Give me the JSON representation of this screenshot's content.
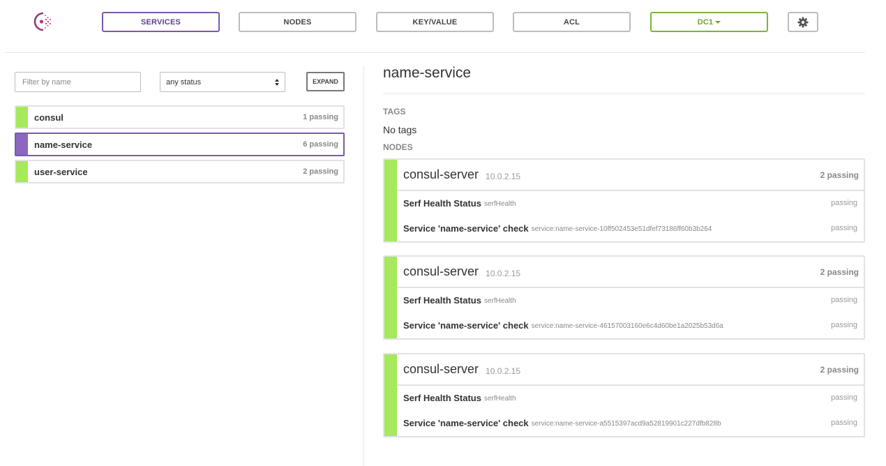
{
  "nav": {
    "services": "SERVICES",
    "nodes": "NODES",
    "key_value": "KEY/VALUE",
    "acl": "ACL",
    "datacenter": "DC1",
    "accent_color": "#7a5aa8",
    "dc_color": "#7bb53a"
  },
  "filters": {
    "name_placeholder": "Filter by name",
    "status_selected": "any status",
    "expand_label": "EXPAND"
  },
  "services": [
    {
      "name": "consul",
      "passing": "1 passing",
      "status_color": "#a6e95d"
    },
    {
      "name": "name-service",
      "passing": "6 passing",
      "selected": true,
      "status_color": "#8c67c0"
    },
    {
      "name": "user-service",
      "passing": "2 passing",
      "status_color": "#a6e95d"
    }
  ],
  "detail": {
    "title": "name-service",
    "tags_label": "TAGS",
    "tags_value": "No tags",
    "nodes_label": "NODES",
    "nodes": [
      {
        "name": "consul-server",
        "address": "10.0.2.15",
        "passing": "2 passing",
        "checks": [
          {
            "name": "Serf Health Status",
            "id": "serfHealth",
            "status": "passing"
          },
          {
            "name": "Service 'name-service' check",
            "id": "service:name-service-10ff502453e51dfef73186ff60b3b264",
            "status": "passing"
          }
        ]
      },
      {
        "name": "consul-server",
        "address": "10.0.2.15",
        "passing": "2 passing",
        "checks": [
          {
            "name": "Serf Health Status",
            "id": "serfHealth",
            "status": "passing"
          },
          {
            "name": "Service 'name-service' check",
            "id": "service:name-service-46157003160e6c4d60be1a2025b53d6a",
            "status": "passing"
          }
        ]
      },
      {
        "name": "consul-server",
        "address": "10.0.2.15",
        "passing": "2 passing",
        "checks": [
          {
            "name": "Serf Health Status",
            "id": "serfHealth",
            "status": "passing"
          },
          {
            "name": "Service 'name-service' check",
            "id": "service:name-service-a5515397acd9a52819901c227dfb828b",
            "status": "passing"
          }
        ]
      }
    ]
  },
  "icons": {
    "logo": "consul-logo-icon",
    "settings": "gear-icon",
    "dc_dropdown": "caret-down-icon"
  }
}
